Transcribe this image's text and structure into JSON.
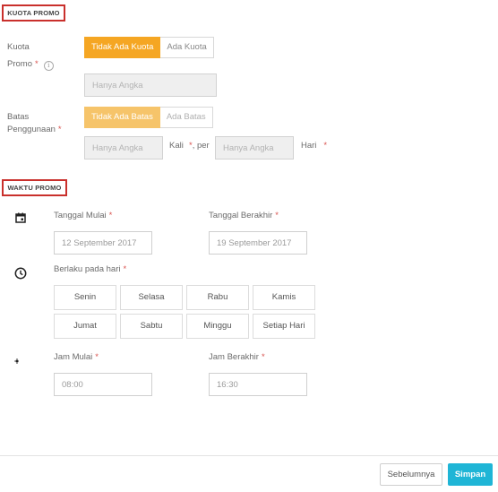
{
  "quota_section": {
    "title": "KUOTA PROMO",
    "kuota": {
      "label_line1": "Kuota",
      "label_line2": "Promo",
      "required": "*",
      "info": "i",
      "option_none": "Tidak Ada Kuota",
      "option_some": "Ada Kuota",
      "input_placeholder": "Hanya Angka"
    },
    "batas": {
      "label_line1": "Batas",
      "label_line2": "Penggunaan",
      "required": "*",
      "option_none": "Tidak Ada Batas",
      "option_some": "Ada Batas",
      "times_placeholder": "Hanya Angka",
      "kali_text": "Kali",
      "per_text": "*, per",
      "days_placeholder": "Hanya Angka",
      "hari_text": "Hari",
      "hari_required": "*"
    }
  },
  "time_section": {
    "title": "WAKTU PROMO",
    "start_date": {
      "label": "Tanggal Mulai",
      "required": "*",
      "value": "12 September 2017"
    },
    "end_date": {
      "label": "Tanggal Berakhir",
      "required": "*",
      "value": "19 September 2017"
    },
    "days": {
      "label": "Berlaku pada hari",
      "required": "*",
      "items": [
        "Senin",
        "Selasa",
        "Rabu",
        "Kamis",
        "Jumat",
        "Sabtu",
        "Minggu",
        "Setiap Hari"
      ]
    },
    "start_time": {
      "label": "Jam Mulai",
      "required": "*",
      "value": "08:00"
    },
    "end_time": {
      "label": "Jam Berakhir",
      "required": "*",
      "value": "16:30"
    }
  },
  "footer": {
    "prev_label": "Sebelumnya",
    "save_label": "Simpan"
  },
  "colors": {
    "accent_orange": "#f5a623",
    "accent_orange_light": "#f6c46a",
    "save_blue": "#1fb5d6",
    "section_border_red": "#c9302c",
    "required_red": "#d9534f"
  }
}
